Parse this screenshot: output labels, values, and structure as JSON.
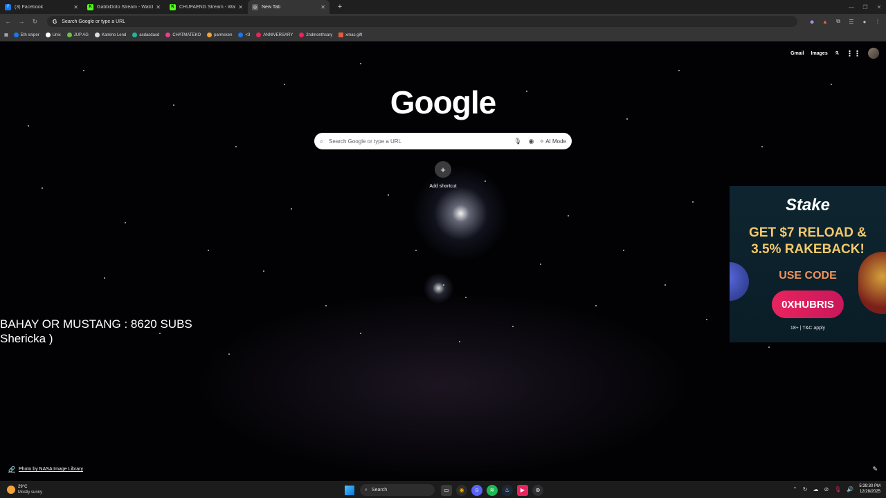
{
  "tabs": [
    {
      "title": "(3) Facebook",
      "icon": "facebook-icon",
      "color": "#1877f2",
      "glyph": "f"
    },
    {
      "title": "GabbiDoto Stream - Watch Live",
      "icon": "kick-icon",
      "color": "#53fc18",
      "glyph": "K"
    },
    {
      "title": "CHUPAENG Stream - Watch Live",
      "icon": "kick-icon",
      "color": "#53fc18",
      "glyph": "K"
    },
    {
      "title": "New Tab",
      "icon": "chrome-icon",
      "color": "#9aa0a6",
      "glyph": "◎"
    }
  ],
  "omnibox": {
    "placeholder": "Search Google or type a URL"
  },
  "bookmarks": [
    {
      "label": "Eth sniper",
      "color": "#1877f2"
    },
    {
      "label": "Unix",
      "color": "#ffffff"
    },
    {
      "label": "JUP AG",
      "color": "#6bc04b"
    },
    {
      "label": "Kamino Lend",
      "color": "#dddddd"
    },
    {
      "label": "asdasdasd",
      "color": "#1fb89a"
    },
    {
      "label": "CHATMATEKO",
      "color": "#e83e8c"
    },
    {
      "label": "parmsken",
      "color": "#f2a33a"
    },
    {
      "label": "<3",
      "color": "#1877f2"
    },
    {
      "label": "ANNIVERSARY",
      "color": "#e8245e"
    },
    {
      "label": "2ndmonthsary",
      "color": "#e8245e"
    },
    {
      "label": "xmas gift",
      "color": "#e25c3c"
    }
  ],
  "header_links": {
    "gmail": "Gmail",
    "images": "Images"
  },
  "logo": "Google",
  "search": {
    "placeholder": "Search Google or type a URL",
    "ai_mode": "AI Mode"
  },
  "shortcut": {
    "label": "Add shortcut"
  },
  "overlay": {
    "line1": "BAHAY OR MUSTANG : 8620 SUBS",
    "line2": "Shericka )"
  },
  "ad": {
    "brand": "Stake",
    "headline1": "GET $7 RELOAD &",
    "headline2": "3.5% RAKEBACK!",
    "use_code": "USE CODE",
    "code": "0XHUBRIS",
    "terms": "18+ | T&C apply"
  },
  "photo_credit": "Photo by NASA Image Library",
  "taskbar": {
    "temperature": "29°C",
    "weather": "Mostly sunny",
    "search": "Search",
    "time": "5:39:30 PM",
    "date": "12/28/2025"
  }
}
